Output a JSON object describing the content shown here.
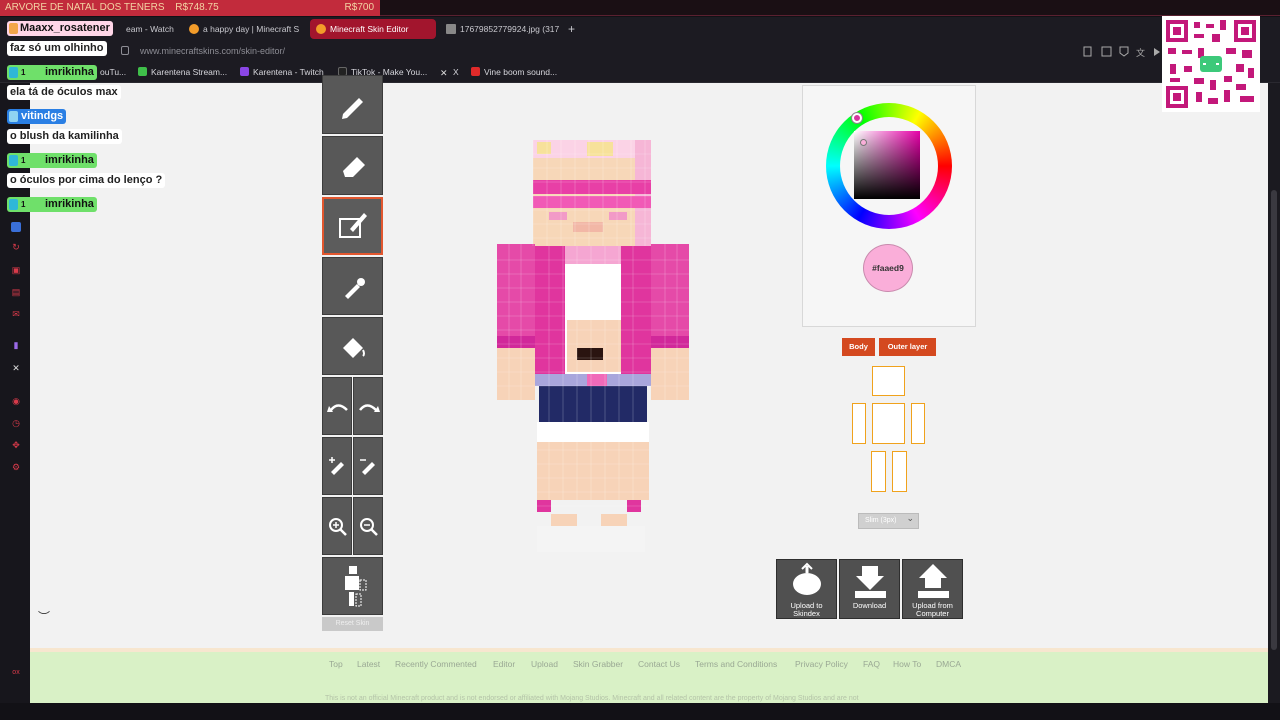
{
  "overlay": {
    "donation_label": "ARVORE DE NATAL DOS TENERS",
    "donation_amount": "R$748.75",
    "donation_goal": "R$700"
  },
  "browser": {
    "tabs": [
      {
        "label": "eam - Watch"
      },
      {
        "label": "a happy day | Minecraft S"
      },
      {
        "label": "Minecraft Skin Editor",
        "active": true
      },
      {
        "label": "17679852779924.jpg (317"
      }
    ],
    "url": "www.minecraftskins.com/skin-editor/",
    "bookmarks": [
      "ouTu...",
      "Karentena Stream...",
      "Karentena - Twitch",
      "TikTok - Make You...",
      "X",
      "Vine boom sound..."
    ]
  },
  "chat": [
    {
      "type": "user",
      "name": "Maaxx_rosatener"
    },
    {
      "type": "msg",
      "text": "faz só um olhinho"
    },
    {
      "type": "user",
      "name": "imrikinha",
      "count": "1"
    },
    {
      "type": "msg",
      "text": "ela tá de óculos max"
    },
    {
      "type": "user",
      "name": "vitindgs"
    },
    {
      "type": "msg",
      "text": "o blush da kamilinha"
    },
    {
      "type": "user",
      "name": "imrikinha",
      "count": "1"
    },
    {
      "type": "msg",
      "text": "o óculos por cima do lenço ?"
    },
    {
      "type": "user",
      "name": "imrikinha",
      "count": "1"
    }
  ],
  "editor": {
    "color_hex": "#faaed9",
    "body_label": "Body",
    "outer_layer_label": "Outer layer",
    "model_select": "Slim (3px)",
    "upload_skindex": "Upload to Skindex",
    "download": "Download",
    "upload_computer": "Upload from Computer",
    "reset_label": "Reset Skin"
  },
  "footer": {
    "links": [
      "Top",
      "Latest",
      "Recently Commented",
      "Editor",
      "Upload",
      "Skin Grabber",
      "Contact Us",
      "Terms and Conditions",
      "Privacy Policy",
      "FAQ",
      "How To",
      "DMCA"
    ],
    "disclaimer": "This is not an official Minecraft product and is not endorsed or affiliated with Mojang Studios. Minecraft and all related content are the property of Mojang Studios and are not"
  },
  "colors": {
    "accent": "#d4491f",
    "brand_red": "#a2152d",
    "footer_bg": "#d9f1c6",
    "selected_color": "#faaed9"
  }
}
